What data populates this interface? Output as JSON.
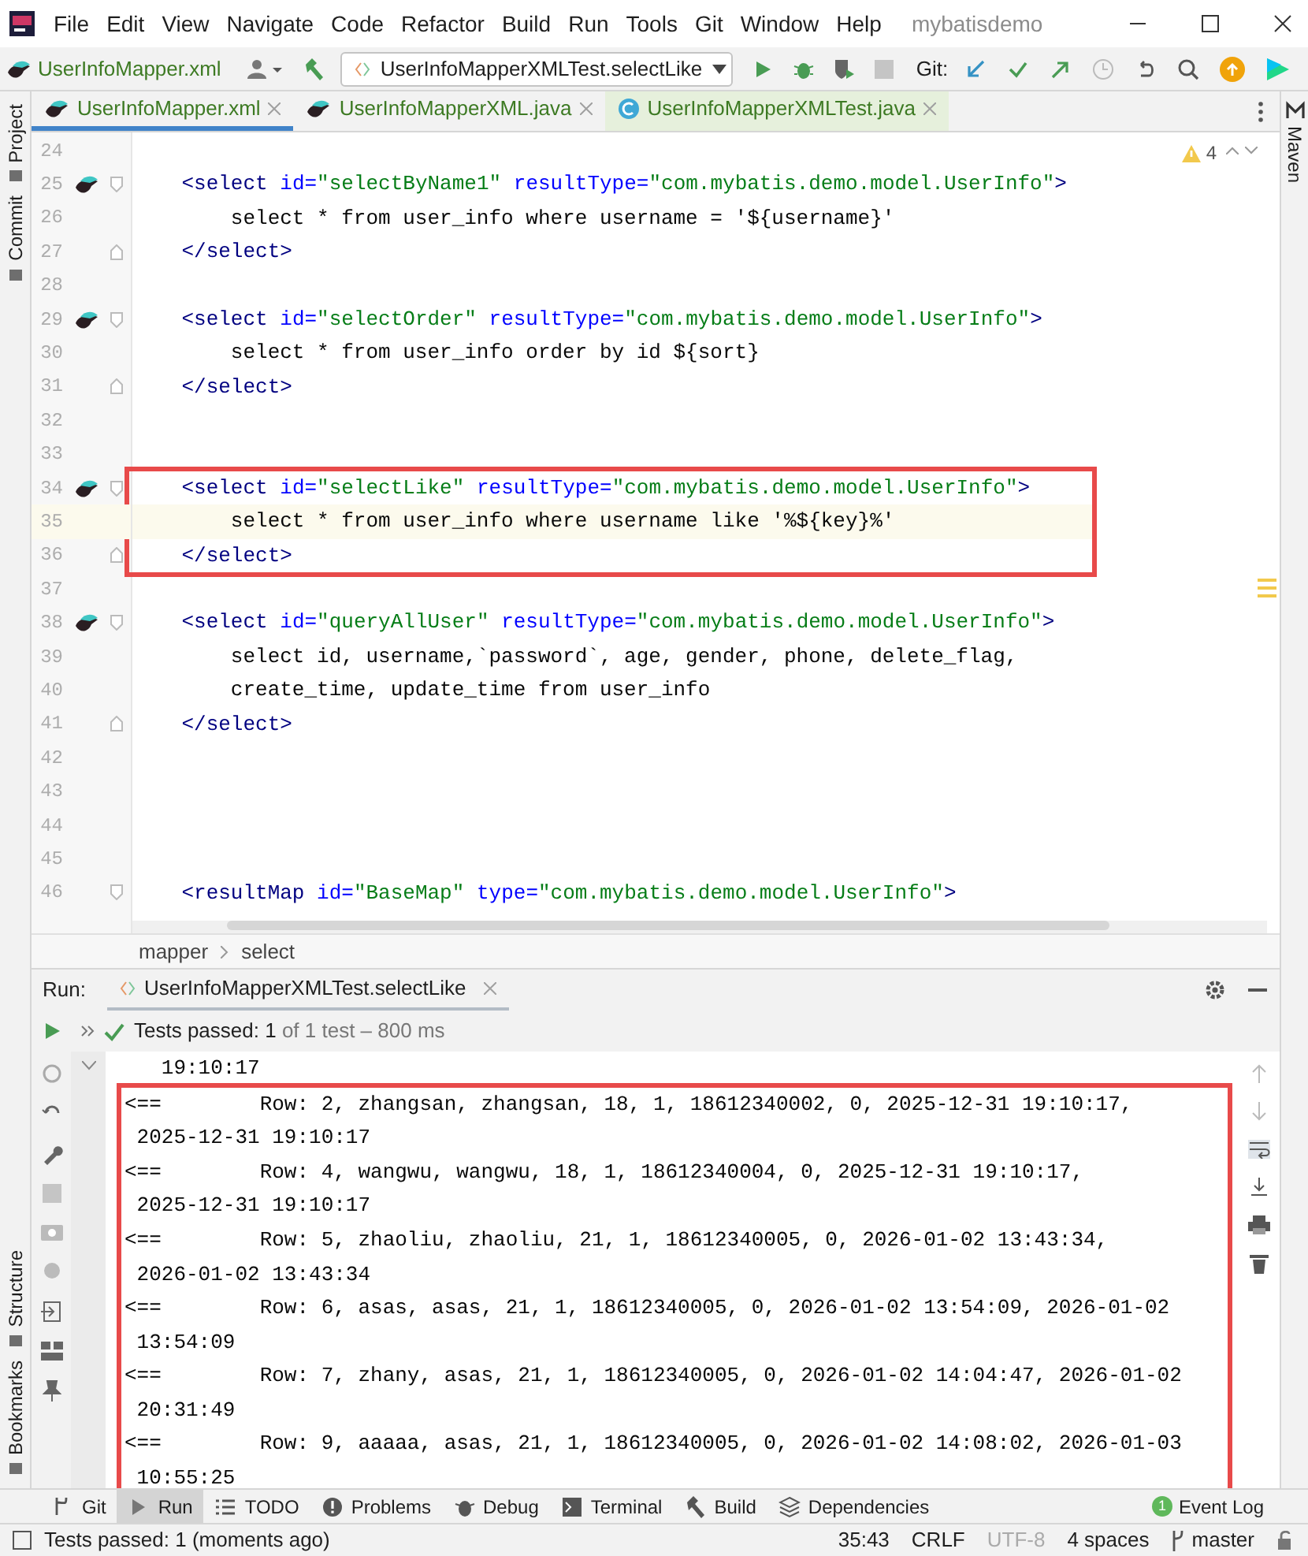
{
  "menu": [
    "File",
    "Edit",
    "View",
    "Navigate",
    "Code",
    "Refactor",
    "Build",
    "Run",
    "Tools",
    "Git",
    "Window",
    "Help"
  ],
  "project_name": "mybatisdemo",
  "toolbar": {
    "file": "UserInfoMapper.xml",
    "run_config": "UserInfoMapperXMLTest.selectLike",
    "git_label": "Git:"
  },
  "tabs": [
    {
      "label": "UserInfoMapper.xml",
      "kind": "mapper",
      "selected": true
    },
    {
      "label": "UserInfoMapperXML.java",
      "kind": "mapper",
      "selected": false
    },
    {
      "label": "UserInfoMapperXMLTest.java",
      "kind": "test",
      "selected": false
    }
  ],
  "left_strip_top": [
    "Project",
    "Commit"
  ],
  "left_strip_bottom": [
    "Structure",
    "Bookmarks"
  ],
  "right_strip": [
    "Maven"
  ],
  "editor": {
    "warnings": "4",
    "lines": [
      {
        "number": "24"
      },
      {
        "number": "25",
        "mapper": true,
        "kind": "open",
        "text": "    <select id=\"selectByName1\" resultType=\"com.mybatis.demo.model.UserInfo\">"
      },
      {
        "number": "26",
        "text": "        select * from user_info where username = '${username}'"
      },
      {
        "number": "27",
        "kind": "close",
        "text": "    </select>"
      },
      {
        "number": "28"
      },
      {
        "number": "29",
        "mapper": true,
        "kind": "open",
        "text": "    <select id=\"selectOrder\" resultType=\"com.mybatis.demo.model.UserInfo\">"
      },
      {
        "number": "30",
        "text": "        select * from user_info order by id ${sort}"
      },
      {
        "number": "31",
        "kind": "close",
        "text": "    </select>"
      },
      {
        "number": "32"
      },
      {
        "number": "33"
      },
      {
        "number": "34",
        "mapper": true,
        "kind": "open",
        "boxed": true,
        "text": "    <select id=\"selectLike\" resultType=\"com.mybatis.demo.model.UserInfo\">"
      },
      {
        "number": "35",
        "current": true,
        "boxed": true,
        "text": "        select * from user_info where username like '%${key}%'"
      },
      {
        "number": "36",
        "kind": "close",
        "boxed": true,
        "text": "    </select>"
      },
      {
        "number": "37"
      },
      {
        "number": "38",
        "mapper": true,
        "kind": "open",
        "text": "    <select id=\"queryAllUser\" resultType=\"com.mybatis.demo.model.UserInfo\">"
      },
      {
        "number": "39",
        "text": "        select id, username,`password`, age, gender, phone, delete_flag,"
      },
      {
        "number": "40",
        "text": "        create_time, update_time from user_info"
      },
      {
        "number": "41",
        "kind": "close",
        "text": "    </select>"
      },
      {
        "number": "42"
      },
      {
        "number": "43"
      },
      {
        "number": "44"
      },
      {
        "number": "45"
      },
      {
        "number": "46",
        "kind": "open",
        "text": "    <resultMap id=\"BaseMap\" type=\"com.mybatis.demo.model.UserInfo\">"
      }
    ]
  },
  "breadcrumb": [
    "mapper",
    "select"
  ],
  "run": {
    "label": "Run:",
    "tab": "UserInfoMapperXMLTest.selectLike",
    "status_bold": "Tests passed: 1",
    "status_rest": "of 1 test – 800 ms",
    "console": [
      {
        "lines": [
          "   19:10:17"
        ]
      },
      {
        "boxed": true,
        "lines": [
          "<==        Row: 2, zhangsan, zhangsan, 18, 1, 18612340002, 0, 2025-12-31 19:10:17,",
          " 2025-12-31 19:10:17"
        ]
      },
      {
        "boxed": true,
        "lines": [
          "<==        Row: 4, wangwu, wangwu, 18, 1, 18612340004, 0, 2025-12-31 19:10:17,",
          " 2025-12-31 19:10:17"
        ]
      },
      {
        "boxed": true,
        "lines": [
          "<==        Row: 5, zhaoliu, zhaoliu, 21, 1, 18612340005, 0, 2026-01-02 13:43:34,",
          " 2026-01-02 13:43:34"
        ]
      },
      {
        "boxed": true,
        "lines": [
          "<==        Row: 6, asas, asas, 21, 1, 18612340005, 0, 2026-01-02 13:54:09, 2026-01-02",
          " 13:54:09"
        ]
      },
      {
        "boxed": true,
        "lines": [
          "<==        Row: 7, zhany, asas, 21, 1, 18612340005, 0, 2026-01-02 14:04:47, 2026-01-02",
          " 20:31:49"
        ]
      },
      {
        "boxed": true,
        "lines": [
          "<==        Row: 9, aaaaa, asas, 21, 1, 18612340005, 0, 2026-01-02 14:08:02, 2026-01-03",
          " 10:55:25"
        ]
      }
    ]
  },
  "tool_windows": [
    {
      "label": "Git",
      "kind": "git",
      "selected": false
    },
    {
      "label": "Run",
      "kind": "run",
      "selected": true
    },
    {
      "label": "TODO",
      "kind": "todo",
      "selected": false
    },
    {
      "label": "Problems",
      "kind": "problems",
      "selected": false
    },
    {
      "label": "Debug",
      "kind": "debug",
      "selected": false
    },
    {
      "label": "Terminal",
      "kind": "terminal",
      "selected": false
    },
    {
      "label": "Build",
      "kind": "build",
      "selected": false
    },
    {
      "label": "Dependencies",
      "kind": "deps",
      "selected": false
    }
  ],
  "event_log": {
    "label": "Event Log",
    "count": "1"
  },
  "status_bar": {
    "message": "Tests passed: 1 (moments ago)",
    "position": "35:43",
    "line_separator": "CRLF",
    "encoding": "UTF-8",
    "indent": "4 spaces",
    "branch": "master"
  }
}
